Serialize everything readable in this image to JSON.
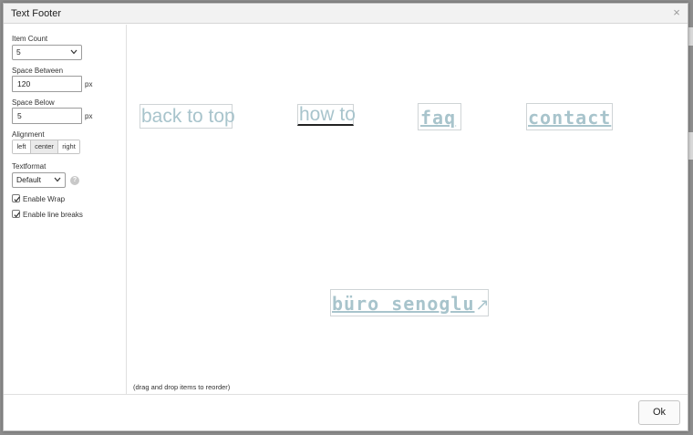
{
  "dialog": {
    "title": "Text Footer",
    "close_icon": "×",
    "ok_label": "Ok"
  },
  "sidebar": {
    "item_count": {
      "label": "Item Count",
      "value": "5"
    },
    "space_between": {
      "label": "Space Between",
      "value": "120",
      "unit": "px"
    },
    "space_below": {
      "label": "Space Below",
      "value": "5",
      "unit": "px"
    },
    "alignment": {
      "label": "Alignment",
      "options": [
        "left",
        "center",
        "right"
      ],
      "selected": "center"
    },
    "textformat": {
      "label": "Textformat",
      "value": "Default",
      "help": "?"
    },
    "enable_wrap": {
      "label": "Enable Wrap",
      "checked": true
    },
    "enable_line_breaks": {
      "label": "Enable line breaks",
      "checked": true
    }
  },
  "canvas": {
    "items": [
      {
        "text": "back to top"
      },
      {
        "text": "how to"
      },
      {
        "text": "faq"
      },
      {
        "text": "contact"
      },
      {
        "text": "büro senoglu",
        "icon": "↗"
      }
    ],
    "hint": "(drag and drop items to reorder)"
  },
  "colors": {
    "item_text": "#a8c4cc",
    "item_border": "#cfd4d6",
    "header_bg": "#f2f2f2",
    "backdrop": "#8d8d8d"
  },
  "icons": {
    "close": "close-icon",
    "chevron": "chevron-down-icon",
    "help": "help-icon",
    "check": "checkmark-icon",
    "external": "external-link-arrow-icon"
  }
}
